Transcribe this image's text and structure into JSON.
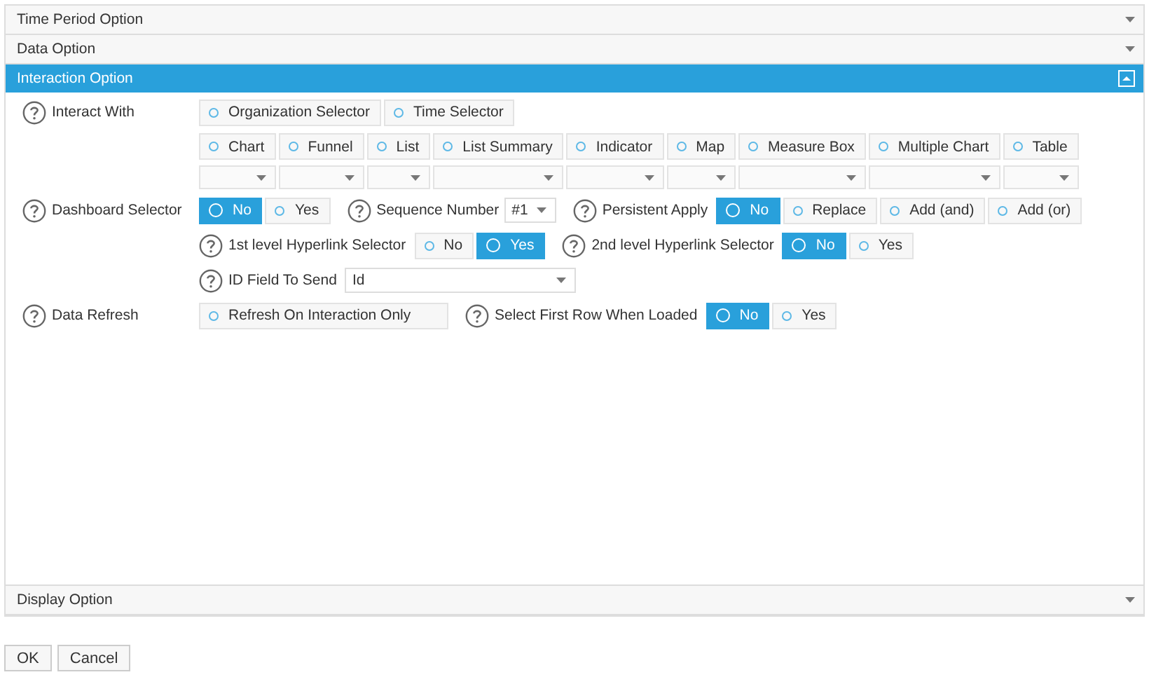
{
  "panels": [
    {
      "title": "Time Period Option",
      "expanded": false
    },
    {
      "title": "Data Option",
      "expanded": false
    },
    {
      "title": "Interaction Option",
      "expanded": true
    },
    {
      "title": "Display Option",
      "expanded": false
    }
  ],
  "interaction": {
    "interact_with": {
      "label": "Interact With",
      "sources": [
        {
          "label": "Organization Selector",
          "selected": false
        },
        {
          "label": "Time Selector",
          "selected": false
        }
      ],
      "widgets": [
        {
          "label": "Chart",
          "selected": false
        },
        {
          "label": "Funnel",
          "selected": false
        },
        {
          "label": "List",
          "selected": false
        },
        {
          "label": "List Summary",
          "selected": false
        },
        {
          "label": "Indicator",
          "selected": false
        },
        {
          "label": "Map",
          "selected": false
        },
        {
          "label": "Measure Box",
          "selected": false
        },
        {
          "label": "Multiple Chart",
          "selected": false
        },
        {
          "label": "Table",
          "selected": false
        }
      ]
    },
    "dashboard_selector": {
      "label": "Dashboard Selector",
      "options": [
        {
          "label": "No",
          "selected": true
        },
        {
          "label": "Yes",
          "selected": false
        }
      ]
    },
    "sequence_number": {
      "label": "Sequence Number",
      "value": "#1"
    },
    "persistent_apply": {
      "label": "Persistent Apply",
      "options": [
        {
          "label": "No",
          "selected": true
        },
        {
          "label": "Replace",
          "selected": false
        },
        {
          "label": "Add (and)",
          "selected": false
        },
        {
          "label": "Add (or)",
          "selected": false
        }
      ]
    },
    "hyperlink_1": {
      "label": "1st level Hyperlink Selector",
      "options": [
        {
          "label": "No",
          "selected": false
        },
        {
          "label": "Yes",
          "selected": true
        }
      ]
    },
    "hyperlink_2": {
      "label": "2nd level Hyperlink Selector",
      "options": [
        {
          "label": "No",
          "selected": true
        },
        {
          "label": "Yes",
          "selected": false
        }
      ]
    },
    "id_field": {
      "label": "ID Field To Send",
      "value": "Id"
    },
    "data_refresh": {
      "label": "Data Refresh",
      "options": [
        {
          "label": "Refresh On Interaction Only",
          "selected": false
        }
      ]
    },
    "select_first_row": {
      "label": "Select First Row When Loaded",
      "options": [
        {
          "label": "No",
          "selected": true
        },
        {
          "label": "Yes",
          "selected": false
        }
      ]
    }
  },
  "buttons": [
    "OK",
    "Cancel"
  ]
}
